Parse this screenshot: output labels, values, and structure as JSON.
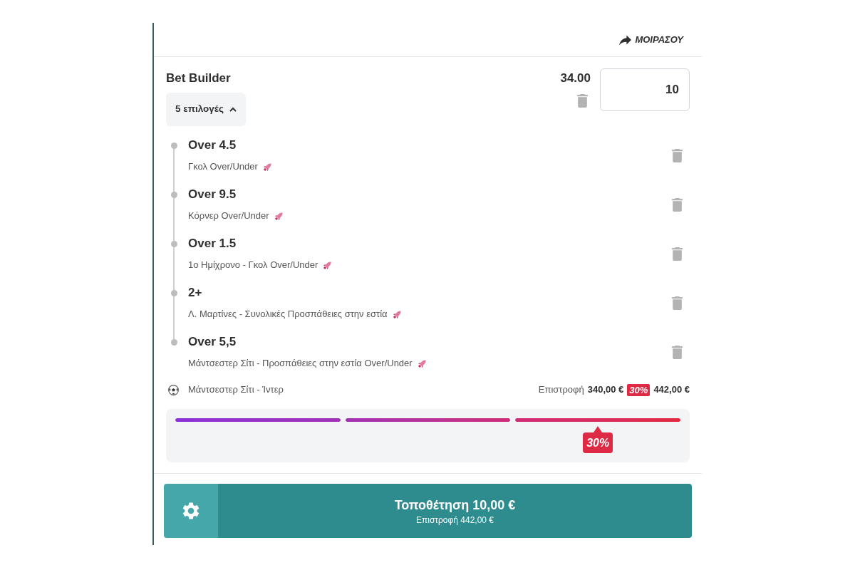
{
  "share": {
    "label": "ΜΟΙΡΑΣΟΥ"
  },
  "bet": {
    "title": "Bet Builder",
    "odds": "34.00",
    "stake": "10",
    "toggle": {
      "label": "5 επιλογές",
      "expanded": true
    }
  },
  "selections": [
    {
      "pick": "Over 4.5",
      "market": "Γκολ Over/Under"
    },
    {
      "pick": "Over 9.5",
      "market": "Κόρνερ Over/Under"
    },
    {
      "pick": "Over 1.5",
      "market": "1ο Ημίχρονο - Γκολ Over/Under"
    },
    {
      "pick": "2+",
      "market": "Λ. Μαρτίνες - Συνολικές Προσπάθειες στην εστία"
    },
    {
      "pick": "Over 5,5",
      "market": "Μάντσεστερ Σίτι - Προσπάθειες στην εστία Over/Under"
    }
  ],
  "match": {
    "name": "Μάντσεστερ Σίτι - Ίντερ",
    "return_label": "Επιστροφή",
    "return_before": "340,00 €",
    "boost": "30%",
    "return_after": "442,00 €"
  },
  "boost_meter": {
    "segments": [
      {
        "level": 1
      },
      {
        "level": 1
      },
      {
        "level": 1
      }
    ],
    "badge": "30%"
  },
  "place_bet": {
    "label": "Τοποθέτηση 10,00 €",
    "return": "Επιστροφή 442,00 €"
  }
}
